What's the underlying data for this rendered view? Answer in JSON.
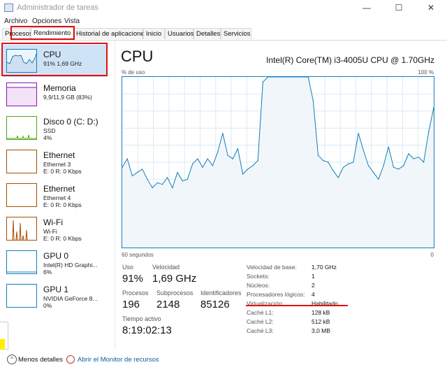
{
  "window": {
    "title": "Administrador de tareas",
    "buttons": {
      "minimize": "—",
      "maximize": "☐",
      "close": "✕"
    }
  },
  "menu": [
    "Archivo",
    "Opciones",
    "Vista"
  ],
  "tabs": [
    {
      "label": "Procesos"
    },
    {
      "label": "Rendimiento",
      "active": true
    },
    {
      "label": "Historial de aplicaciones"
    },
    {
      "label": "Inicio"
    },
    {
      "label": "Usuarios"
    },
    {
      "label": "Detalles"
    },
    {
      "label": "Servicios"
    }
  ],
  "sidebar": {
    "items": [
      {
        "name": "CPU",
        "line1": "91% 1,69 GHz",
        "line2": "",
        "color": "#117dbb",
        "fill": "#d9ebf7"
      },
      {
        "name": "Memoria",
        "line1": "9,9/11,9 GB (83%)",
        "line2": "",
        "color": "#8b12ae",
        "fill": "#f3e3f7"
      },
      {
        "name": "Disco 0 (C: D:)",
        "line1": "SSD",
        "line2": "4%",
        "color": "#4da60c",
        "fill": "#eff7e6"
      },
      {
        "name": "Ethernet",
        "line1": "Ethernet 3",
        "line2": "E: 0 R: 0 Kbps",
        "color": "#a74f01",
        "fill": "#fcf3eb"
      },
      {
        "name": "Ethernet",
        "line1": "Ethernet 4",
        "line2": "E: 0 R: 0 Kbps",
        "color": "#a74f01",
        "fill": "#fcf3eb"
      },
      {
        "name": "Wi-Fi",
        "line1": "Wi-Fi",
        "line2": "E: 0 R: 0 Kbps",
        "color": "#a74f01",
        "fill": "#fcf3eb"
      },
      {
        "name": "GPU 0",
        "line1": "Intel(R) HD Graphi...",
        "line2": "6%",
        "color": "#117dbb",
        "fill": "#d9ebf7"
      },
      {
        "name": "GPU 1",
        "line1": "NVIDIA GeForce 8...",
        "line2": "0%",
        "color": "#117dbb",
        "fill": "#d9ebf7"
      }
    ]
  },
  "main": {
    "title": "CPU",
    "cpu_name": "Intel(R) Core(TM) i3-4005U CPU @ 1.70GHz",
    "graph_label_top_left": "% de uso",
    "graph_label_top_right": "100 %",
    "graph_label_bottom_left": "60 segundos",
    "graph_label_bottom_right": "0",
    "stats": {
      "uso_label": "Uso",
      "uso_value": "91%",
      "velocidad_label": "Velocidad",
      "velocidad_value": "1,69 GHz",
      "procesos_label": "Procesos",
      "procesos_value": "196",
      "subprocesos_label": "Subprocesos",
      "subprocesos_value": "2148",
      "identificadores_label": "Identificadores",
      "identificadores_value": "85126",
      "tiempo_label": "Tiempo activo",
      "tiempo_value": "8:19:02:13"
    },
    "details": [
      {
        "label": "Velocidad de base:",
        "value": "1,70 GHz"
      },
      {
        "label": "Sockets:",
        "value": "1"
      },
      {
        "label": "Núcleos:",
        "value": "2"
      },
      {
        "label": "Procesadores lógicos:",
        "value": "4"
      },
      {
        "label": "Virtualización:",
        "value": "Habilitado"
      },
      {
        "label": "Caché L1:",
        "value": "128 kB"
      },
      {
        "label": "Caché L2:",
        "value": "512 kB"
      },
      {
        "label": "Caché L3:",
        "value": "3,0 MB"
      }
    ]
  },
  "chart_data": {
    "type": "area",
    "y_range": [
      0,
      100
    ],
    "series": [
      {
        "values": [
          47,
          52,
          42,
          44,
          46,
          40,
          35,
          38,
          37,
          41,
          35,
          44,
          39,
          40,
          49,
          52,
          47,
          52,
          48,
          56,
          67,
          54,
          52,
          58,
          43,
          46,
          48,
          51,
          97,
          100,
          100,
          100,
          100,
          100,
          100,
          100,
          100,
          100,
          86,
          54,
          51,
          50,
          45,
          41,
          47,
          49,
          50,
          67,
          57,
          48,
          44,
          40,
          48,
          59,
          47,
          46,
          48,
          55,
          52,
          53,
          50,
          68,
          82
        ]
      }
    ]
  },
  "footer": {
    "less_details": "Menos detalles",
    "monitor_link": "Abrir el Monitor de recursos"
  },
  "colors": {
    "cpu_line": "#117dbb",
    "cpu_fill": "#f1f6fa",
    "annotation_red": "#e01010",
    "selected_bg": "#cfe3f7"
  }
}
